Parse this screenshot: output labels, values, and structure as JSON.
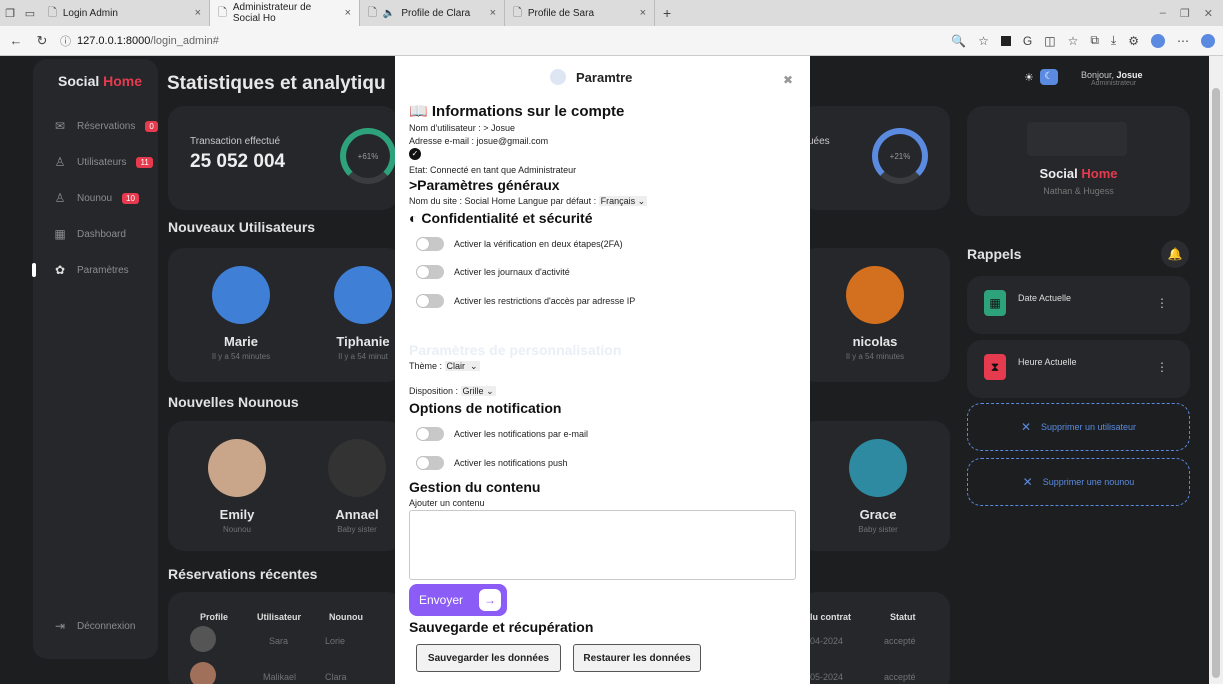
{
  "browser": {
    "tabs": [
      {
        "label": "Login Admin"
      },
      {
        "label": "Administrateur de Social Ho"
      },
      {
        "label": "Profile de Clara"
      },
      {
        "label": "Profile de Sara"
      }
    ],
    "url_host": "127.0.0.1:8000",
    "url_path": "/login_admin#"
  },
  "sidebar": {
    "brand_a": "Social ",
    "brand_b": "Home",
    "items": [
      {
        "label": "Réservations",
        "badge": "0"
      },
      {
        "label": "Utilisateurs",
        "badge": "11"
      },
      {
        "label": "Nounou",
        "badge": "10"
      },
      {
        "label": "Dashboard"
      },
      {
        "label": "Paramètres"
      }
    ],
    "logout": "Déconnexion"
  },
  "main": {
    "title": "Statistiques et analytiqu",
    "stat1_label": "Transaction effectué",
    "stat1_value": "25 052 004",
    "stat1_pct": "+61%",
    "stat2_label": "uées",
    "stat2_pct": "+21%",
    "new_users_title": "Nouveaux Utilisateurs",
    "users": [
      {
        "name": "Marie",
        "sub": "Il y a 54 minutes"
      },
      {
        "name": "Tiphanie",
        "sub": "Il y a 54 minut"
      },
      {
        "name": "nicolas",
        "sub": "Il y a 54 minutes"
      }
    ],
    "new_nannies_title": "Nouvelles Nounous",
    "nannies": [
      {
        "name": "Emily",
        "sub": "Nounou"
      },
      {
        "name": "Annael",
        "sub": "Baby sister"
      },
      {
        "name": "Grace",
        "sub": "Baby sister"
      }
    ],
    "recent_title": "Réservations récentes",
    "table_headers": {
      "profile": "Profile",
      "user": "Utilisateur",
      "nanny": "Nounou",
      "contract": "lu contrat",
      "status": "Statut"
    },
    "rows": [
      {
        "user": "Sara",
        "nanny": "Lorie",
        "date": "04-2024",
        "status": "accepté"
      },
      {
        "user": "Malikael",
        "nanny": "Clara",
        "date": "05-2024",
        "status": "accepté"
      }
    ]
  },
  "right": {
    "greeting": "Bonjour, ",
    "user": "Josue",
    "role": "Administrateur",
    "brand_a": "Social ",
    "brand_b": "Home",
    "brand_sub": "Nathan & Hugess",
    "rappels": "Rappels",
    "rem1": "Date Actuelle",
    "rem2": "Heure Actuelle",
    "del_user": "Supprimer un utilisateur",
    "del_nanny": "Supprimer une nounou"
  },
  "modal": {
    "title": "Paramtre",
    "account_h": "Informations sur le compte",
    "username": "Nom d'utilisateur : > Josue",
    "email": "Adresse e-mail : josue@gmail.com",
    "state": "Etat: Connecté en tant que Administrateur",
    "general_h": ">Paramètres généraux",
    "site_name": "Nom du site : Social Home Langue par défaut :",
    "lang_value": "Français",
    "privacy_h": "Confidentialité et sécurité",
    "sw_2fa": "Activer la vérification en deux étapes(2FA)",
    "sw_logs": "Activer les journaux d'activité",
    "sw_ip": "Activer les restrictions d'accès par adresse IP",
    "personal_h": "Paramètres de personnalisation",
    "theme_label": "Thème :",
    "theme_value": "Clair",
    "layout_label": "Disposition :",
    "layout_value": "Grille",
    "notif_h": "Options de notification",
    "sw_email": "Activer les notifications par e-mail",
    "sw_push": "Activer les notifications push",
    "content_h": "Gestion du contenu",
    "content_label": "Ajouter un contenu",
    "send": "Envoyer",
    "backup_h": "Sauvegarde et récupération",
    "save_btn": "Sauvegarder les données",
    "restore_btn": "Restaurer les données"
  },
  "colors": {
    "accent": "#e63a4e",
    "blue": "#5b8be0",
    "purple": "#8b5cf6"
  }
}
